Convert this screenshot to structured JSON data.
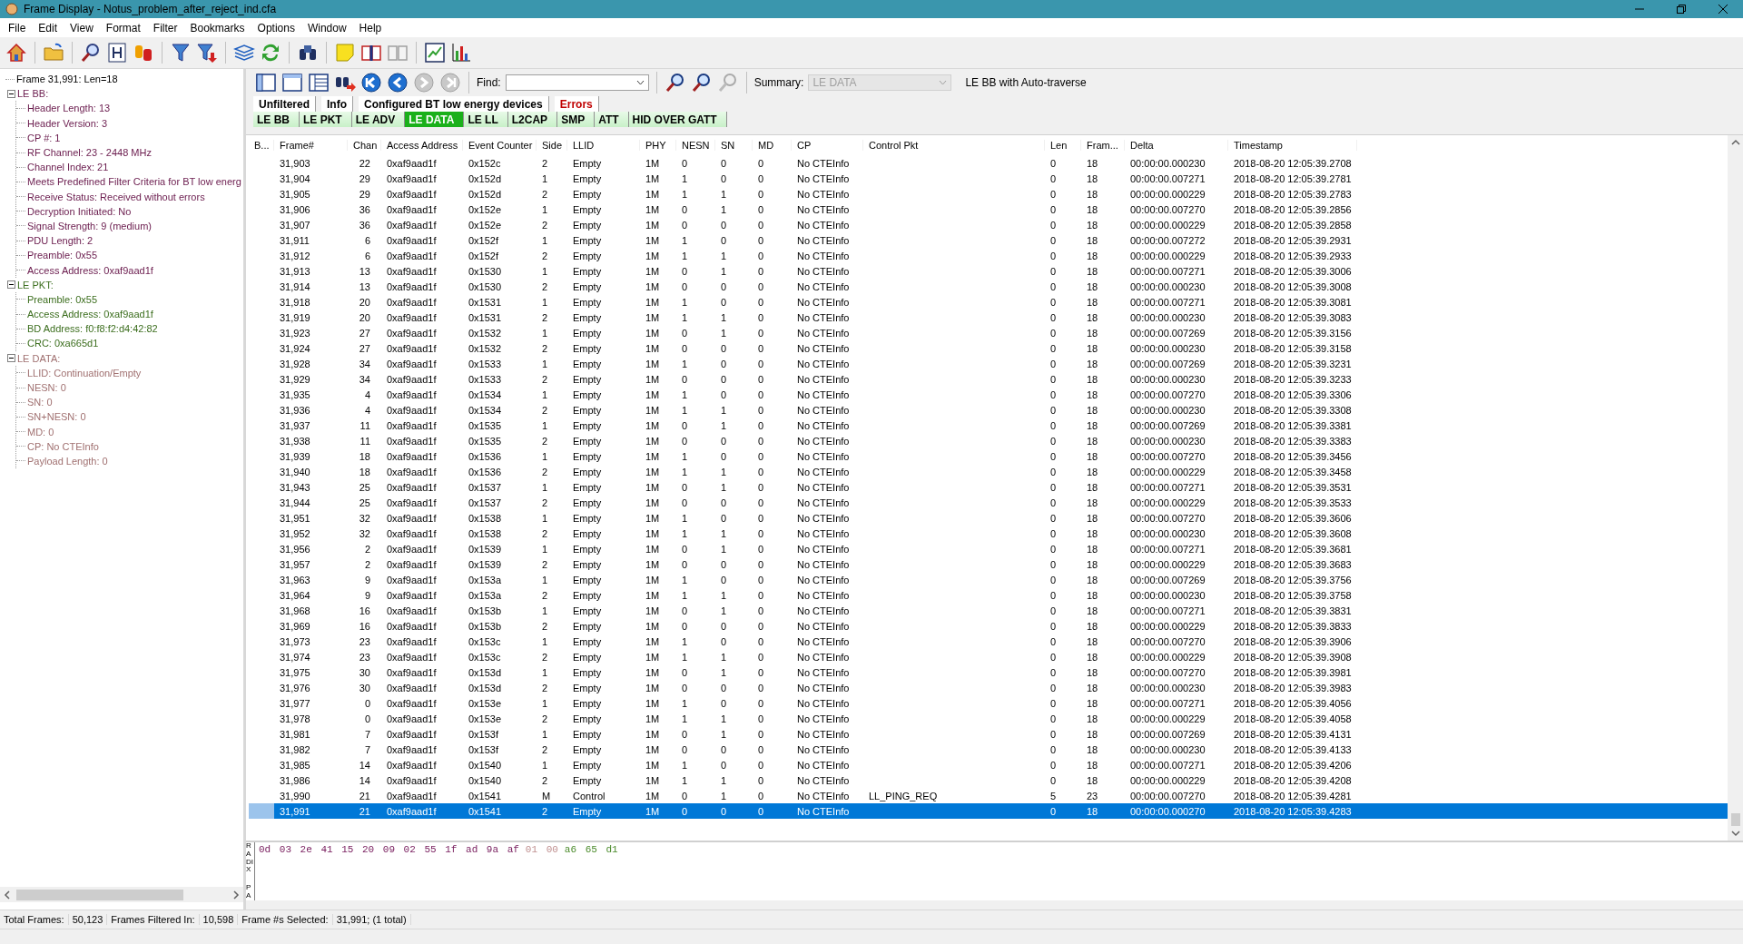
{
  "window": {
    "title": "Frame Display - Notus_problem_after_reject_ind.cfa"
  },
  "menu": [
    "File",
    "Edit",
    "View",
    "Format",
    "Filter",
    "Bookmarks",
    "Options",
    "Window",
    "Help"
  ],
  "tree": [
    {
      "label": "Frame 31,991:  Len=18",
      "color": "#000000"
    },
    {
      "label": "LE BB:",
      "expanded": true,
      "color": "#6a1b4d",
      "children": [
        {
          "label": "Header Length: 13"
        },
        {
          "label": "Header Version: 3"
        },
        {
          "label": "CP #: 1"
        },
        {
          "label": "RF Channel: 23 - 2448 MHz"
        },
        {
          "label": "Channel Index: 21"
        },
        {
          "label": "Meets Predefined Filter Criteria for BT low energ"
        },
        {
          "label": "Receive Status: Received without errors"
        },
        {
          "label": "Decryption Initiated: No"
        },
        {
          "label": "Signal Strength: 9 (medium)"
        },
        {
          "label": "PDU Length: 2"
        },
        {
          "label": "Preamble: 0x55"
        },
        {
          "label": "Access Address: 0xaf9aad1f"
        }
      ]
    },
    {
      "label": "LE PKT:",
      "expanded": true,
      "color": "#3c6e1e",
      "children": [
        {
          "label": "Preamble: 0x55"
        },
        {
          "label": "Access Address: 0xaf9aad1f"
        },
        {
          "label": "BD Address: f0:f8:f2:d4:42:82"
        },
        {
          "label": "CRC: 0xa665d1"
        }
      ]
    },
    {
      "label": "LE DATA:",
      "expanded": true,
      "color": "#a07070",
      "children": [
        {
          "label": "LLID: Continuation/Empty"
        },
        {
          "label": "NESN: 0"
        },
        {
          "label": "SN: 0"
        },
        {
          "label": "SN+NESN: 0"
        },
        {
          "label": "MD: 0"
        },
        {
          "label": "CP: No CTEInfo"
        },
        {
          "label": "Payload Length: 0"
        }
      ]
    }
  ],
  "navigation": [
    {
      "disabled": false
    },
    {
      "disabled": false
    },
    {
      "disabled": true
    },
    {
      "disabled": true
    }
  ],
  "find": {
    "label": "Find:",
    "find_buttons": [
      {
        "disabled": false
      },
      {
        "disabled": false
      },
      {
        "disabled": true
      }
    ]
  },
  "summary": {
    "label": "Summary:",
    "value": "LE DATA",
    "disabled": true,
    "note": "LE BB with Auto-traverse"
  },
  "filter_tabs": [
    {
      "label": "Unfiltered",
      "selected": false,
      "color": "#000000"
    },
    {
      "label": "Info",
      "selected": false,
      "color": "#000000"
    },
    {
      "label": "Configured BT low energy devices",
      "selected": false,
      "color": "#000000"
    },
    {
      "label": "Errors",
      "selected": false,
      "color": "#c00000"
    }
  ],
  "protocol_tabs": [
    {
      "label": "LE BB",
      "selected": false
    },
    {
      "label": "LE PKT",
      "selected": false
    },
    {
      "label": "LE ADV",
      "selected": false
    },
    {
      "label": "LE DATA",
      "selected": true
    },
    {
      "label": "LE LL",
      "selected": false
    },
    {
      "label": "L2CAP",
      "selected": false
    },
    {
      "label": "SMP",
      "selected": false
    },
    {
      "label": "ATT",
      "selected": false
    },
    {
      "label": "HID OVER GATT",
      "selected": false
    }
  ],
  "table": {
    "columns": [
      "B...",
      "Frame#",
      "Chan",
      "Access Address",
      "Event Counter",
      "Side",
      "LLID",
      "PHY",
      "NESN",
      "SN",
      "MD",
      "CP",
      "Control Pkt",
      "Len",
      "Fram...",
      "Delta",
      "Timestamp"
    ],
    "rows": [
      {
        "selected": false,
        "cells": [
          "",
          "31,903",
          "22",
          "0xaf9aad1f",
          "0x152c",
          "2",
          "Empty",
          "1M",
          "0",
          "0",
          "0",
          "No CTEInfo",
          "",
          "0",
          "18",
          "00:00:00.000230",
          "2018-08-20 12:05:39.2708"
        ]
      },
      {
        "selected": false,
        "cells": [
          "",
          "31,904",
          "29",
          "0xaf9aad1f",
          "0x152d",
          "1",
          "Empty",
          "1M",
          "1",
          "0",
          "0",
          "No CTEInfo",
          "",
          "0",
          "18",
          "00:00:00.007271",
          "2018-08-20 12:05:39.2781"
        ]
      },
      {
        "selected": false,
        "cells": [
          "",
          "31,905",
          "29",
          "0xaf9aad1f",
          "0x152d",
          "2",
          "Empty",
          "1M",
          "1",
          "1",
          "0",
          "No CTEInfo",
          "",
          "0",
          "18",
          "00:00:00.000229",
          "2018-08-20 12:05:39.2783"
        ]
      },
      {
        "selected": false,
        "cells": [
          "",
          "31,906",
          "36",
          "0xaf9aad1f",
          "0x152e",
          "1",
          "Empty",
          "1M",
          "0",
          "1",
          "0",
          "No CTEInfo",
          "",
          "0",
          "18",
          "00:00:00.007270",
          "2018-08-20 12:05:39.2856"
        ]
      },
      {
        "selected": false,
        "cells": [
          "",
          "31,907",
          "36",
          "0xaf9aad1f",
          "0x152e",
          "2",
          "Empty",
          "1M",
          "0",
          "0",
          "0",
          "No CTEInfo",
          "",
          "0",
          "18",
          "00:00:00.000229",
          "2018-08-20 12:05:39.2858"
        ]
      },
      {
        "selected": false,
        "cells": [
          "",
          "31,911",
          "6",
          "0xaf9aad1f",
          "0x152f",
          "1",
          "Empty",
          "1M",
          "1",
          "0",
          "0",
          "No CTEInfo",
          "",
          "0",
          "18",
          "00:00:00.007272",
          "2018-08-20 12:05:39.2931"
        ]
      },
      {
        "selected": false,
        "cells": [
          "",
          "31,912",
          "6",
          "0xaf9aad1f",
          "0x152f",
          "2",
          "Empty",
          "1M",
          "1",
          "1",
          "0",
          "No CTEInfo",
          "",
          "0",
          "18",
          "00:00:00.000229",
          "2018-08-20 12:05:39.2933"
        ]
      },
      {
        "selected": false,
        "cells": [
          "",
          "31,913",
          "13",
          "0xaf9aad1f",
          "0x1530",
          "1",
          "Empty",
          "1M",
          "0",
          "1",
          "0",
          "No CTEInfo",
          "",
          "0",
          "18",
          "00:00:00.007271",
          "2018-08-20 12:05:39.3006"
        ]
      },
      {
        "selected": false,
        "cells": [
          "",
          "31,914",
          "13",
          "0xaf9aad1f",
          "0x1530",
          "2",
          "Empty",
          "1M",
          "0",
          "0",
          "0",
          "No CTEInfo",
          "",
          "0",
          "18",
          "00:00:00.000230",
          "2018-08-20 12:05:39.3008"
        ]
      },
      {
        "selected": false,
        "cells": [
          "",
          "31,918",
          "20",
          "0xaf9aad1f",
          "0x1531",
          "1",
          "Empty",
          "1M",
          "1",
          "0",
          "0",
          "No CTEInfo",
          "",
          "0",
          "18",
          "00:00:00.007271",
          "2018-08-20 12:05:39.3081"
        ]
      },
      {
        "selected": false,
        "cells": [
          "",
          "31,919",
          "20",
          "0xaf9aad1f",
          "0x1531",
          "2",
          "Empty",
          "1M",
          "1",
          "1",
          "0",
          "No CTEInfo",
          "",
          "0",
          "18",
          "00:00:00.000230",
          "2018-08-20 12:05:39.3083"
        ]
      },
      {
        "selected": false,
        "cells": [
          "",
          "31,923",
          "27",
          "0xaf9aad1f",
          "0x1532",
          "1",
          "Empty",
          "1M",
          "0",
          "1",
          "0",
          "No CTEInfo",
          "",
          "0",
          "18",
          "00:00:00.007269",
          "2018-08-20 12:05:39.3156"
        ]
      },
      {
        "selected": false,
        "cells": [
          "",
          "31,924",
          "27",
          "0xaf9aad1f",
          "0x1532",
          "2",
          "Empty",
          "1M",
          "0",
          "0",
          "0",
          "No CTEInfo",
          "",
          "0",
          "18",
          "00:00:00.000230",
          "2018-08-20 12:05:39.3158"
        ]
      },
      {
        "selected": false,
        "cells": [
          "",
          "31,928",
          "34",
          "0xaf9aad1f",
          "0x1533",
          "1",
          "Empty",
          "1M",
          "1",
          "0",
          "0",
          "No CTEInfo",
          "",
          "0",
          "18",
          "00:00:00.007269",
          "2018-08-20 12:05:39.3231"
        ]
      },
      {
        "selected": false,
        "cells": [
          "",
          "31,929",
          "34",
          "0xaf9aad1f",
          "0x1533",
          "2",
          "Empty",
          "1M",
          "0",
          "0",
          "0",
          "No CTEInfo",
          "",
          "0",
          "18",
          "00:00:00.000230",
          "2018-08-20 12:05:39.3233"
        ]
      },
      {
        "selected": false,
        "cells": [
          "",
          "31,935",
          "4",
          "0xaf9aad1f",
          "0x1534",
          "1",
          "Empty",
          "1M",
          "1",
          "0",
          "0",
          "No CTEInfo",
          "",
          "0",
          "18",
          "00:00:00.007270",
          "2018-08-20 12:05:39.3306"
        ]
      },
      {
        "selected": false,
        "cells": [
          "",
          "31,936",
          "4",
          "0xaf9aad1f",
          "0x1534",
          "2",
          "Empty",
          "1M",
          "1",
          "1",
          "0",
          "No CTEInfo",
          "",
          "0",
          "18",
          "00:00:00.000230",
          "2018-08-20 12:05:39.3308"
        ]
      },
      {
        "selected": false,
        "cells": [
          "",
          "31,937",
          "11",
          "0xaf9aad1f",
          "0x1535",
          "1",
          "Empty",
          "1M",
          "0",
          "1",
          "0",
          "No CTEInfo",
          "",
          "0",
          "18",
          "00:00:00.007269",
          "2018-08-20 12:05:39.3381"
        ]
      },
      {
        "selected": false,
        "cells": [
          "",
          "31,938",
          "11",
          "0xaf9aad1f",
          "0x1535",
          "2",
          "Empty",
          "1M",
          "0",
          "0",
          "0",
          "No CTEInfo",
          "",
          "0",
          "18",
          "00:00:00.000230",
          "2018-08-20 12:05:39.3383"
        ]
      },
      {
        "selected": false,
        "cells": [
          "",
          "31,939",
          "18",
          "0xaf9aad1f",
          "0x1536",
          "1",
          "Empty",
          "1M",
          "1",
          "0",
          "0",
          "No CTEInfo",
          "",
          "0",
          "18",
          "00:00:00.007270",
          "2018-08-20 12:05:39.3456"
        ]
      },
      {
        "selected": false,
        "cells": [
          "",
          "31,940",
          "18",
          "0xaf9aad1f",
          "0x1536",
          "2",
          "Empty",
          "1M",
          "1",
          "1",
          "0",
          "No CTEInfo",
          "",
          "0",
          "18",
          "00:00:00.000229",
          "2018-08-20 12:05:39.3458"
        ]
      },
      {
        "selected": false,
        "cells": [
          "",
          "31,943",
          "25",
          "0xaf9aad1f",
          "0x1537",
          "1",
          "Empty",
          "1M",
          "0",
          "1",
          "0",
          "No CTEInfo",
          "",
          "0",
          "18",
          "00:00:00.007271",
          "2018-08-20 12:05:39.3531"
        ]
      },
      {
        "selected": false,
        "cells": [
          "",
          "31,944",
          "25",
          "0xaf9aad1f",
          "0x1537",
          "2",
          "Empty",
          "1M",
          "0",
          "0",
          "0",
          "No CTEInfo",
          "",
          "0",
          "18",
          "00:00:00.000229",
          "2018-08-20 12:05:39.3533"
        ]
      },
      {
        "selected": false,
        "cells": [
          "",
          "31,951",
          "32",
          "0xaf9aad1f",
          "0x1538",
          "1",
          "Empty",
          "1M",
          "1",
          "0",
          "0",
          "No CTEInfo",
          "",
          "0",
          "18",
          "00:00:00.007270",
          "2018-08-20 12:05:39.3606"
        ]
      },
      {
        "selected": false,
        "cells": [
          "",
          "31,952",
          "32",
          "0xaf9aad1f",
          "0x1538",
          "2",
          "Empty",
          "1M",
          "1",
          "1",
          "0",
          "No CTEInfo",
          "",
          "0",
          "18",
          "00:00:00.000230",
          "2018-08-20 12:05:39.3608"
        ]
      },
      {
        "selected": false,
        "cells": [
          "",
          "31,956",
          "2",
          "0xaf9aad1f",
          "0x1539",
          "1",
          "Empty",
          "1M",
          "0",
          "1",
          "0",
          "No CTEInfo",
          "",
          "0",
          "18",
          "00:00:00.007271",
          "2018-08-20 12:05:39.3681"
        ]
      },
      {
        "selected": false,
        "cells": [
          "",
          "31,957",
          "2",
          "0xaf9aad1f",
          "0x1539",
          "2",
          "Empty",
          "1M",
          "0",
          "0",
          "0",
          "No CTEInfo",
          "",
          "0",
          "18",
          "00:00:00.000229",
          "2018-08-20 12:05:39.3683"
        ]
      },
      {
        "selected": false,
        "cells": [
          "",
          "31,963",
          "9",
          "0xaf9aad1f",
          "0x153a",
          "1",
          "Empty",
          "1M",
          "1",
          "0",
          "0",
          "No CTEInfo",
          "",
          "0",
          "18",
          "00:00:00.007269",
          "2018-08-20 12:05:39.3756"
        ]
      },
      {
        "selected": false,
        "cells": [
          "",
          "31,964",
          "9",
          "0xaf9aad1f",
          "0x153a",
          "2",
          "Empty",
          "1M",
          "1",
          "1",
          "0",
          "No CTEInfo",
          "",
          "0",
          "18",
          "00:00:00.000230",
          "2018-08-20 12:05:39.3758"
        ]
      },
      {
        "selected": false,
        "cells": [
          "",
          "31,968",
          "16",
          "0xaf9aad1f",
          "0x153b",
          "1",
          "Empty",
          "1M",
          "0",
          "1",
          "0",
          "No CTEInfo",
          "",
          "0",
          "18",
          "00:00:00.007271",
          "2018-08-20 12:05:39.3831"
        ]
      },
      {
        "selected": false,
        "cells": [
          "",
          "31,969",
          "16",
          "0xaf9aad1f",
          "0x153b",
          "2",
          "Empty",
          "1M",
          "0",
          "0",
          "0",
          "No CTEInfo",
          "",
          "0",
          "18",
          "00:00:00.000229",
          "2018-08-20 12:05:39.3833"
        ]
      },
      {
        "selected": false,
        "cells": [
          "",
          "31,973",
          "23",
          "0xaf9aad1f",
          "0x153c",
          "1",
          "Empty",
          "1M",
          "1",
          "0",
          "0",
          "No CTEInfo",
          "",
          "0",
          "18",
          "00:00:00.007270",
          "2018-08-20 12:05:39.3906"
        ]
      },
      {
        "selected": false,
        "cells": [
          "",
          "31,974",
          "23",
          "0xaf9aad1f",
          "0x153c",
          "2",
          "Empty",
          "1M",
          "1",
          "1",
          "0",
          "No CTEInfo",
          "",
          "0",
          "18",
          "00:00:00.000229",
          "2018-08-20 12:05:39.3908"
        ]
      },
      {
        "selected": false,
        "cells": [
          "",
          "31,975",
          "30",
          "0xaf9aad1f",
          "0x153d",
          "1",
          "Empty",
          "1M",
          "0",
          "1",
          "0",
          "No CTEInfo",
          "",
          "0",
          "18",
          "00:00:00.007270",
          "2018-08-20 12:05:39.3981"
        ]
      },
      {
        "selected": false,
        "cells": [
          "",
          "31,976",
          "30",
          "0xaf9aad1f",
          "0x153d",
          "2",
          "Empty",
          "1M",
          "0",
          "0",
          "0",
          "No CTEInfo",
          "",
          "0",
          "18",
          "00:00:00.000230",
          "2018-08-20 12:05:39.3983"
        ]
      },
      {
        "selected": false,
        "cells": [
          "",
          "31,977",
          "0",
          "0xaf9aad1f",
          "0x153e",
          "1",
          "Empty",
          "1M",
          "1",
          "0",
          "0",
          "No CTEInfo",
          "",
          "0",
          "18",
          "00:00:00.007271",
          "2018-08-20 12:05:39.4056"
        ]
      },
      {
        "selected": false,
        "cells": [
          "",
          "31,978",
          "0",
          "0xaf9aad1f",
          "0x153e",
          "2",
          "Empty",
          "1M",
          "1",
          "1",
          "0",
          "No CTEInfo",
          "",
          "0",
          "18",
          "00:00:00.000229",
          "2018-08-20 12:05:39.4058"
        ]
      },
      {
        "selected": false,
        "cells": [
          "",
          "31,981",
          "7",
          "0xaf9aad1f",
          "0x153f",
          "1",
          "Empty",
          "1M",
          "0",
          "1",
          "0",
          "No CTEInfo",
          "",
          "0",
          "18",
          "00:00:00.007269",
          "2018-08-20 12:05:39.4131"
        ]
      },
      {
        "selected": false,
        "cells": [
          "",
          "31,982",
          "7",
          "0xaf9aad1f",
          "0x153f",
          "2",
          "Empty",
          "1M",
          "0",
          "0",
          "0",
          "No CTEInfo",
          "",
          "0",
          "18",
          "00:00:00.000230",
          "2018-08-20 12:05:39.4133"
        ]
      },
      {
        "selected": false,
        "cells": [
          "",
          "31,985",
          "14",
          "0xaf9aad1f",
          "0x1540",
          "1",
          "Empty",
          "1M",
          "1",
          "0",
          "0",
          "No CTEInfo",
          "",
          "0",
          "18",
          "00:00:00.007271",
          "2018-08-20 12:05:39.4206"
        ]
      },
      {
        "selected": false,
        "cells": [
          "",
          "31,986",
          "14",
          "0xaf9aad1f",
          "0x1540",
          "2",
          "Empty",
          "1M",
          "1",
          "1",
          "0",
          "No CTEInfo",
          "",
          "0",
          "18",
          "00:00:00.000229",
          "2018-08-20 12:05:39.4208"
        ]
      },
      {
        "selected": false,
        "cells": [
          "",
          "31,990",
          "21",
          "0xaf9aad1f",
          "0x1541",
          "M",
          "Control",
          "1M",
          "0",
          "1",
          "0",
          "No CTEInfo",
          "LL_PING_REQ",
          "5",
          "23",
          "00:00:00.007270",
          "2018-08-20 12:05:39.4281"
        ]
      },
      {
        "selected": true,
        "cells": [
          "",
          "31,991",
          "21",
          "0xaf9aad1f",
          "0x1541",
          "2",
          "Empty",
          "1M",
          "0",
          "0",
          "0",
          "No CTEInfo",
          "",
          "0",
          "18",
          "00:00:00.000270",
          "2018-08-20 12:05:39.4283"
        ]
      }
    ]
  },
  "hex": {
    "side_labels": [
      "RADIX",
      "PA"
    ],
    "groups": [
      {
        "text": "0d 03 2e 41 15 20 09 02 55 1f ad 9a af",
        "color": "#7a2060"
      },
      {
        "text": "01 00",
        "color": "#c09090"
      },
      {
        "text": "a6 65 d1",
        "color": "#4a8a2a"
      }
    ]
  },
  "status_bar": [
    {
      "label": "Total Frames:",
      "value": "50,123"
    },
    {
      "label": "Frames Filtered In:",
      "value": "10,598"
    },
    {
      "label": "Frame #s Selected:",
      "value": "31,991; (1 total)"
    }
  ]
}
